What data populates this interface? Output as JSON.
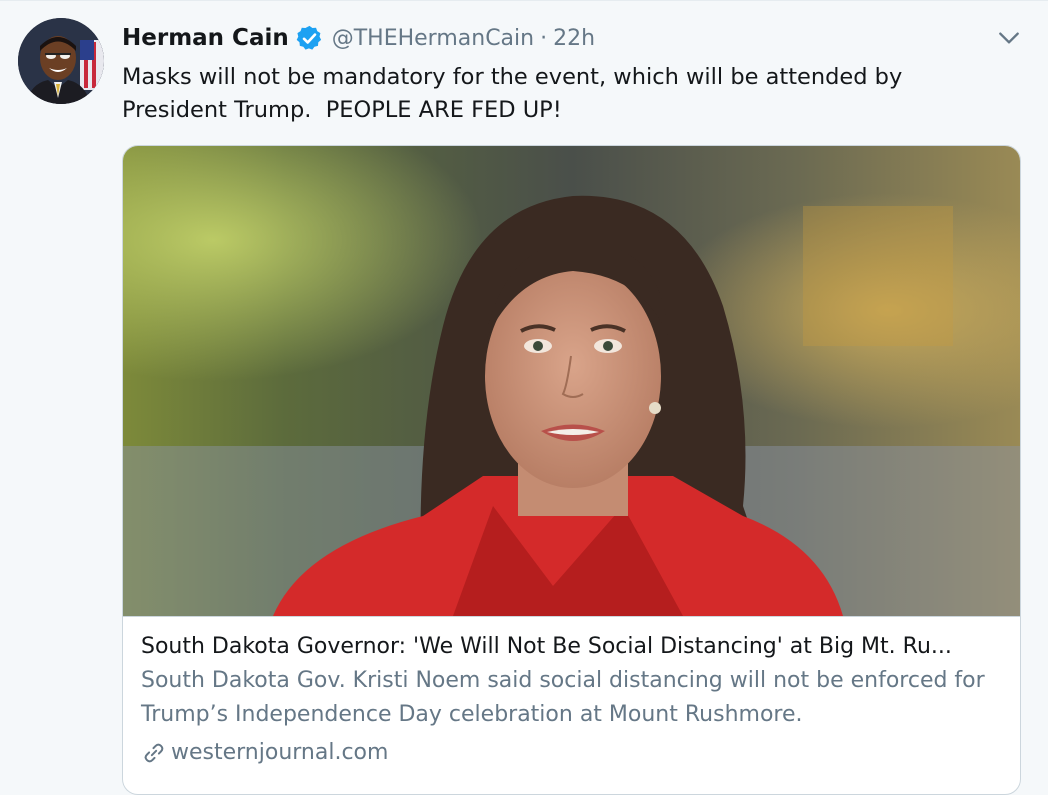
{
  "author": {
    "name": "Herman Cain",
    "handle": "@THEHermanCain",
    "separator": "·",
    "time": "22h",
    "verified_icon": "verified-badge-icon",
    "avatar": "avatar-photo"
  },
  "menu": {
    "icon": "chevron-down-icon"
  },
  "tweet": {
    "text": "Masks will not be mandatory for the event, which will be attended by\nPresident Trump.  PEOPLE ARE FED UP!"
  },
  "card": {
    "image": "news-photo",
    "title": "South Dakota Governor: 'We Will Not Be Social Distancing' at Big Mt. Ru...",
    "description": "South Dakota Gov. Kristi Noem said social distancing will not be enforced for Trump’s Independence Day celebration at Mount Rushmore.",
    "domain": "westernjournal.com",
    "domain_icon": "link-icon"
  },
  "colors": {
    "background": "#f5f8fa",
    "primary_text": "#14171a",
    "secondary_text": "#657786",
    "verified_blue": "#1da1f2",
    "border": "#ccd6dd"
  }
}
